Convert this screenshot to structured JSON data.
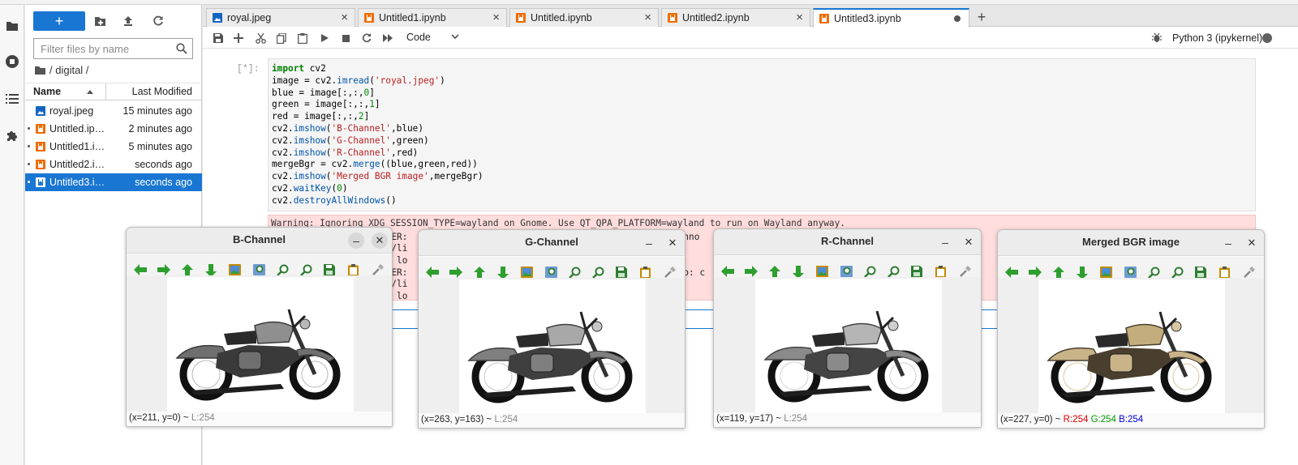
{
  "file_browser": {
    "new_label": "+",
    "filter_placeholder": "Filter files by name",
    "breadcrumb": "/ digital /",
    "col_name": "Name",
    "col_modified": "Last Modified",
    "files": [
      {
        "name": "royal.jpeg",
        "modified": "15 minutes ago",
        "kind": "image-icon",
        "open": false,
        "selected": false
      },
      {
        "name": "Untitled.ip…",
        "modified": "2 minutes ago",
        "kind": "notebook-icon",
        "open": true,
        "selected": false
      },
      {
        "name": "Untitled1.i…",
        "modified": "5 minutes ago",
        "kind": "notebook-icon",
        "open": true,
        "selected": false
      },
      {
        "name": "Untitled2.i…",
        "modified": "seconds ago",
        "kind": "notebook-icon",
        "open": true,
        "selected": false
      },
      {
        "name": "Untitled3.i…",
        "modified": "seconds ago",
        "kind": "notebook-icon",
        "open": true,
        "selected": true
      }
    ]
  },
  "tabs": [
    {
      "label": "royal.jpeg",
      "kind": "image-icon"
    },
    {
      "label": "Untitled1.ipynb",
      "kind": "notebook-icon"
    },
    {
      "label": "Untitled.ipynb",
      "kind": "notebook-icon"
    },
    {
      "label": "Untitled2.ipynb",
      "kind": "notebook-icon"
    },
    {
      "label": "Untitled3.ipynb",
      "kind": "notebook-icon"
    }
  ],
  "toolbar": {
    "cell_type": "Code",
    "kernel_name": "Python 3 (ipykernel)"
  },
  "cell": {
    "prompt": "[*]:",
    "code_lines": [
      "import cv2",
      "image = cv2.imread('royal.jpeg')",
      "blue = image[:,:,0]",
      "green = image[:,:,1]",
      "red = image[:,:,2]",
      "cv2.imshow('B-Channel',blue)",
      "cv2.imshow('G-Channel',green)",
      "cv2.imshow('R-Channel',red)",
      "mergeBgr = cv2.merge((blue,green,red))",
      "cv2.imshow('Merged BGR image',mergeBgr)",
      "cv2.waitKey(0)",
      "cv2.destroyAllWindows()"
    ],
    "output_visible": {
      "line1": "Warning: Ignoring XDG_SESSION_TYPE=wayland on Gnome. Use QT_QPA_PLATFORM=wayland to run on Wayland anyway.",
      "line2a": "ADER:",
      "line2b": "canno",
      "line2c": "ecto",
      "line3": "sr/li",
      "line4": "to lo",
      "line5a": "ADER:",
      "line5b": ".so: c",
      "line5c": "dir",
      "line5d": "dr",
      "line6": "sr/li",
      "line7": "to lo"
    }
  },
  "cv_windows": [
    {
      "title": "B-Channel",
      "coords": "(x=211, y=0) ~ ",
      "level": "L:254",
      "tint": "blue"
    },
    {
      "title": "G-Channel",
      "coords": "(x=263, y=163) ~ ",
      "level": "L:254",
      "tint": "green"
    },
    {
      "title": "R-Channel",
      "coords": "(x=119, y=17) ~ ",
      "level": "L:254",
      "tint": "red"
    },
    {
      "title": "Merged BGR image",
      "coords": "(x=227, y=0) ~ ",
      "r": "R:254",
      "g": "G:254",
      "b": "B:254",
      "tint": "color"
    }
  ],
  "colors": {
    "accent": "#1976d2",
    "error_bg": "#ffdddd"
  }
}
